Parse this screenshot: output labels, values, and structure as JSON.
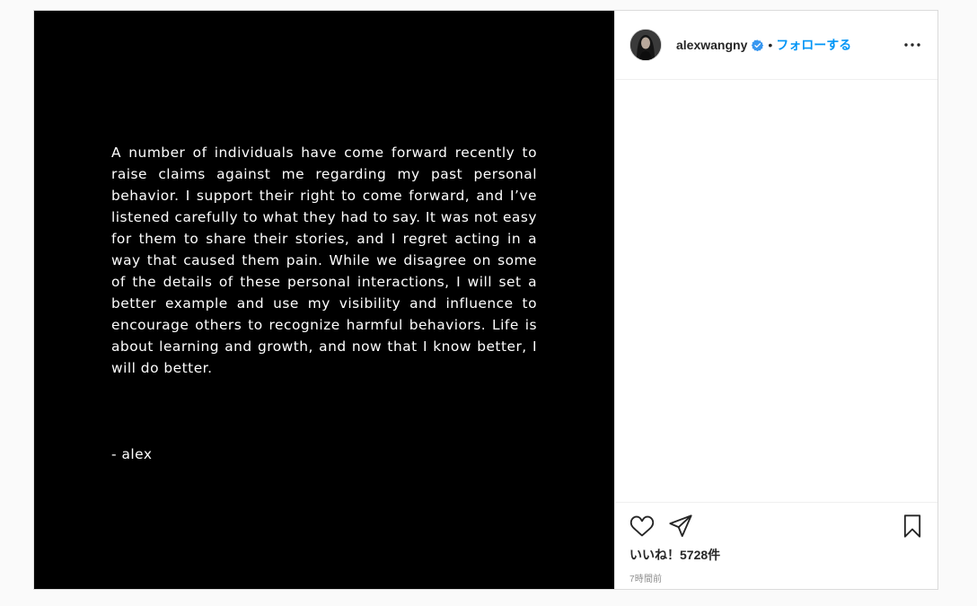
{
  "post": {
    "statement": "A number of individuals have come forward recently to raise claims against me regarding my past personal behavior. I support their right to come forward, and I’ve listened carefully to what they had to say. It was not easy for them to share their stories, and I regret acting in a way that caused them pain. While we disagree on some of the details of these personal interactions, I will set a better example and use my visibility and influence to encourage others to recognize harmful behaviors. Life is about learning and growth, and now that I know better, I will do better.",
    "signature": "- alex"
  },
  "header": {
    "username": "alexwangny",
    "verified": true,
    "separator": "•",
    "follow_label": "フォローする",
    "avatar_icon": "profile-avatar",
    "more_icon": "more-options-icon"
  },
  "actions": {
    "like_icon": "heart-icon",
    "share_icon": "paper-plane-icon",
    "save_icon": "bookmark-icon",
    "likes_text": "いいね！5728件",
    "time_text": "7時間前"
  },
  "colors": {
    "accent": "#0095f6",
    "text": "#262626",
    "muted": "#8e8e8e",
    "media_bg": "#000000"
  }
}
